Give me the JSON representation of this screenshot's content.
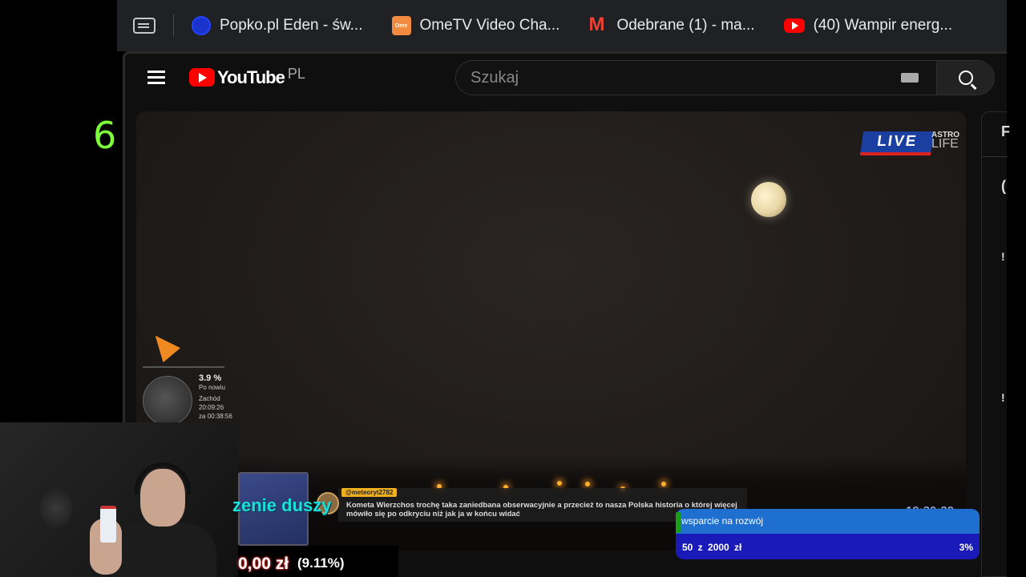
{
  "browser": {
    "bookmarks": [
      {
        "label": "Popko.pl Eden - św...",
        "icon": "popko-favicon"
      },
      {
        "label": "OmeTV Video Cha...",
        "icon": "ometv-favicon"
      },
      {
        "label": "Odebrane (1) - ma...",
        "icon": "gmail-favicon"
      },
      {
        "label": "(40) Wampir energ...",
        "icon": "youtube-favicon"
      }
    ]
  },
  "overlay": {
    "left_counter": "6"
  },
  "youtube": {
    "logo_text": "YouTube",
    "country_code": "PL",
    "search_placeholder": "Szukaj"
  },
  "video": {
    "live_label": "LIVE",
    "brand_top": "ASTRO",
    "brand_bottom": "LIFE",
    "moon_phase_pct": "3.9 %",
    "moon_phase_label": "Po nowiu",
    "direction": "Zachód",
    "time_1": "20:09:26",
    "time_2": "za 00:38:56",
    "chat_user": "@meteoryt2782",
    "chat_message": "Kometa Wierzchos trochę taka zaniedbana obserwacyjnie a przecież to nasza Polska historia o której więcej mówiło się po odkryciu niż jak ja w końcu widać",
    "clock": "19:30:30"
  },
  "sidepanel": {
    "chars": [
      "F",
      "(",
      "!",
      "!"
    ]
  },
  "stream_alert": {
    "title": "zenie duszy"
  },
  "donation": {
    "amount": "0,00 zł",
    "percent": "(9.11%)"
  },
  "goal": {
    "label": "wsparcie na rozwój",
    "progress": "50 z 2000 zł",
    "percent": "3%"
  },
  "colors": {
    "counter": "#7dff3a",
    "goal_top": "#1e6fd0",
    "goal_bottom": "#1a1ab8",
    "alert_title": "#19e0d8"
  }
}
